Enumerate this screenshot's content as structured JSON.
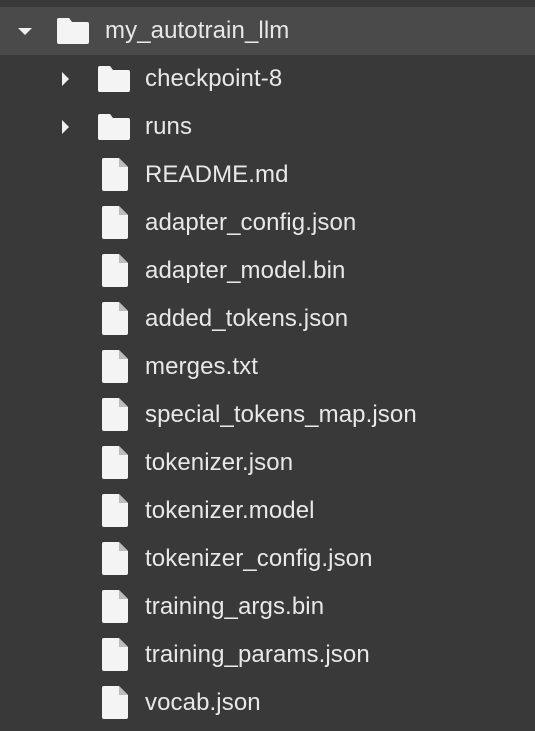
{
  "colors": {
    "background": "#393939",
    "selected_row": "#4a4a4a",
    "text": "#e8e8e8",
    "icon": "#f4f4f4"
  },
  "root": {
    "label": "my_autotrain_llm",
    "icon": "folder-icon",
    "expanded": true
  },
  "folders": [
    {
      "label": "checkpoint-8",
      "icon": "folder-icon",
      "expanded": false
    },
    {
      "label": "runs",
      "icon": "folder-icon",
      "expanded": false
    }
  ],
  "files": [
    {
      "label": "README.md",
      "icon": "file-icon"
    },
    {
      "label": "adapter_config.json",
      "icon": "file-icon"
    },
    {
      "label": "adapter_model.bin",
      "icon": "file-icon"
    },
    {
      "label": "added_tokens.json",
      "icon": "file-icon"
    },
    {
      "label": "merges.txt",
      "icon": "file-icon"
    },
    {
      "label": "special_tokens_map.json",
      "icon": "file-icon"
    },
    {
      "label": "tokenizer.json",
      "icon": "file-icon"
    },
    {
      "label": "tokenizer.model",
      "icon": "file-icon"
    },
    {
      "label": "tokenizer_config.json",
      "icon": "file-icon"
    },
    {
      "label": "training_args.bin",
      "icon": "file-icon"
    },
    {
      "label": "training_params.json",
      "icon": "file-icon"
    },
    {
      "label": "vocab.json",
      "icon": "file-icon"
    }
  ]
}
